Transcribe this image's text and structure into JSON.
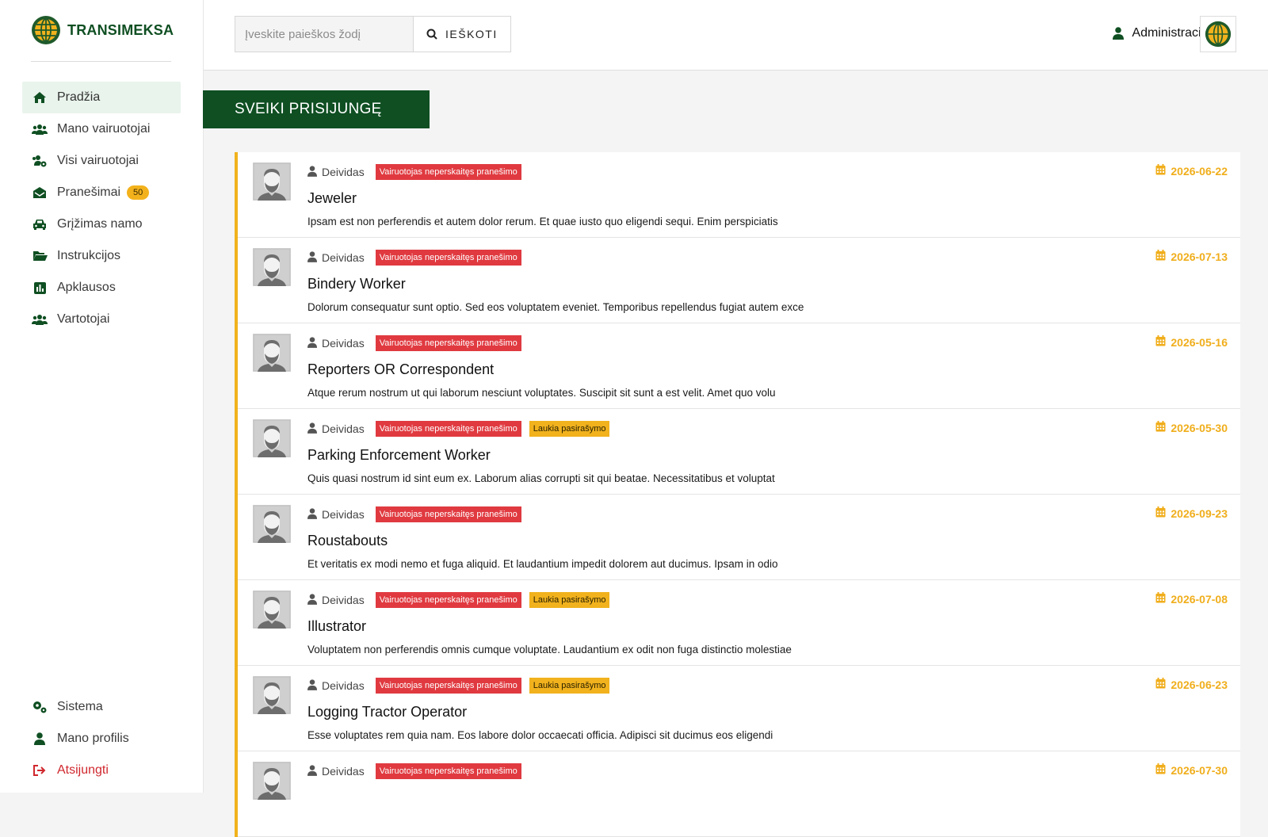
{
  "brand": {
    "name": "TRANSIMEKSA"
  },
  "sidebar": {
    "items": [
      {
        "label": "Pradžia",
        "icon": "home-icon",
        "active": true
      },
      {
        "label": "Mano vairuotojai",
        "icon": "users-icon"
      },
      {
        "label": "Visi vairuotojai",
        "icon": "users-cog-icon"
      },
      {
        "label": "Pranešimai",
        "icon": "envelope-open-icon",
        "badge": "50"
      },
      {
        "label": "Grįžimas namo",
        "icon": "car-icon"
      },
      {
        "label": "Instrukcijos",
        "icon": "folder-open-icon"
      },
      {
        "label": "Apklausos",
        "icon": "poll-icon"
      },
      {
        "label": "Vartotojai",
        "icon": "users-icon"
      }
    ],
    "bottom": [
      {
        "label": "Sistema",
        "icon": "cogs-icon"
      },
      {
        "label": "Mano profilis",
        "icon": "user-icon"
      },
      {
        "label": "Atsijungti",
        "icon": "sign-out-icon"
      }
    ]
  },
  "header": {
    "search_placeholder": "Įveskite paieškos žodį",
    "search_button": "IEŠKOTI",
    "user_label": "Administracija"
  },
  "banner": {
    "title": "SVEIKI PRISIJUNGĘ"
  },
  "tags": {
    "unread": "Vairuotojas neperskaitęs pranešimo",
    "pending": "Laukia pasirašymo"
  },
  "colors": {
    "brand_green": "#0f4f22",
    "accent_yellow": "#f0b21d",
    "tag_red": "#e03a40"
  },
  "messages": [
    {
      "author": "Deividas",
      "pending": false,
      "date": "2026-06-22",
      "title": "Jeweler",
      "text": "Ipsam est non perferendis et autem dolor rerum. Et quae iusto quo eligendi sequi. Enim perspiciatis"
    },
    {
      "author": "Deividas",
      "pending": false,
      "date": "2026-07-13",
      "title": "Bindery Worker",
      "text": "Dolorum consequatur sunt optio. Sed eos voluptatem eveniet. Temporibus repellendus fugiat autem exce"
    },
    {
      "author": "Deividas",
      "pending": false,
      "date": "2026-05-16",
      "title": "Reporters OR Correspondent",
      "text": "Atque rerum nostrum ut qui laborum nesciunt voluptates. Suscipit sit sunt a est velit. Amet quo volu"
    },
    {
      "author": "Deividas",
      "pending": true,
      "date": "2026-05-30",
      "title": "Parking Enforcement Worker",
      "text": "Quis quasi nostrum id sint eum ex. Laborum alias corrupti sit qui beatae. Necessitatibus et voluptat"
    },
    {
      "author": "Deividas",
      "pending": false,
      "date": "2026-09-23",
      "title": "Roustabouts",
      "text": "Et veritatis ex modi nemo et fuga aliquid. Et laudantium impedit dolorem aut ducimus. Ipsam in odio"
    },
    {
      "author": "Deividas",
      "pending": true,
      "date": "2026-07-08",
      "title": "Illustrator",
      "text": "Voluptatem non perferendis omnis cumque voluptate. Laudantium ex odit non fuga distinctio molestiae"
    },
    {
      "author": "Deividas",
      "pending": true,
      "date": "2026-06-23",
      "title": "Logging Tractor Operator",
      "text": "Esse voluptates rem quia nam. Eos labore dolor occaecati officia. Adipisci sit ducimus eos eligendi"
    },
    {
      "author": "Deividas",
      "pending": false,
      "date": "2026-07-30",
      "title": "",
      "text": ""
    }
  ]
}
